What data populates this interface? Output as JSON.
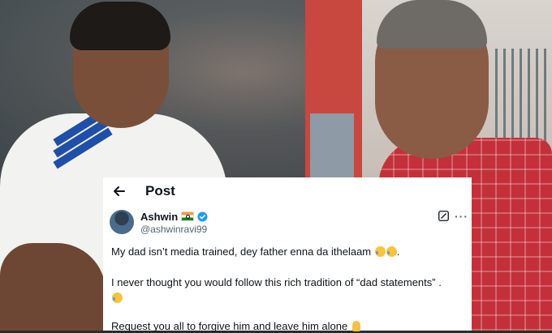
{
  "post_header": {
    "title": "Post"
  },
  "author": {
    "display_name": "Ashwin",
    "handle": "@ashwinravi99"
  },
  "tweet": {
    "line1": "My dad isn’t media trained, dey father enna da ithelaam",
    "line1_end": ".",
    "line2": "I never thought you would follow this rich tradition of “dad statements” .",
    "line4": "Request you all to forgive him and leave him alone"
  },
  "icons": {
    "back": "arrow-left-icon",
    "verified": "verified-badge-icon",
    "grok": "grok-icon",
    "more": "more-options-icon",
    "flag": "india-flag-icon"
  },
  "colors": {
    "verified_blue": "#1d9bf0",
    "text_primary": "#0f1419",
    "text_secondary": "#536471"
  }
}
